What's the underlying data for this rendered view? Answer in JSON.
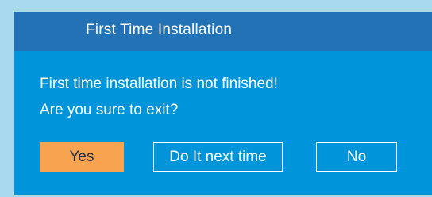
{
  "dialog": {
    "title": "First Time Installation",
    "message_line1": "First time installation is not finished!",
    "message_line2": "Are you sure to exit?",
    "buttons": {
      "yes": "Yes",
      "later": "Do It next time",
      "no": "No"
    },
    "selected_button": "yes"
  },
  "colors": {
    "background": "#a9d9ee",
    "dialog_body": "#0095db",
    "title_bar": "#2372b5",
    "selected_button": "#f7a34f",
    "text": "#ffffff"
  }
}
